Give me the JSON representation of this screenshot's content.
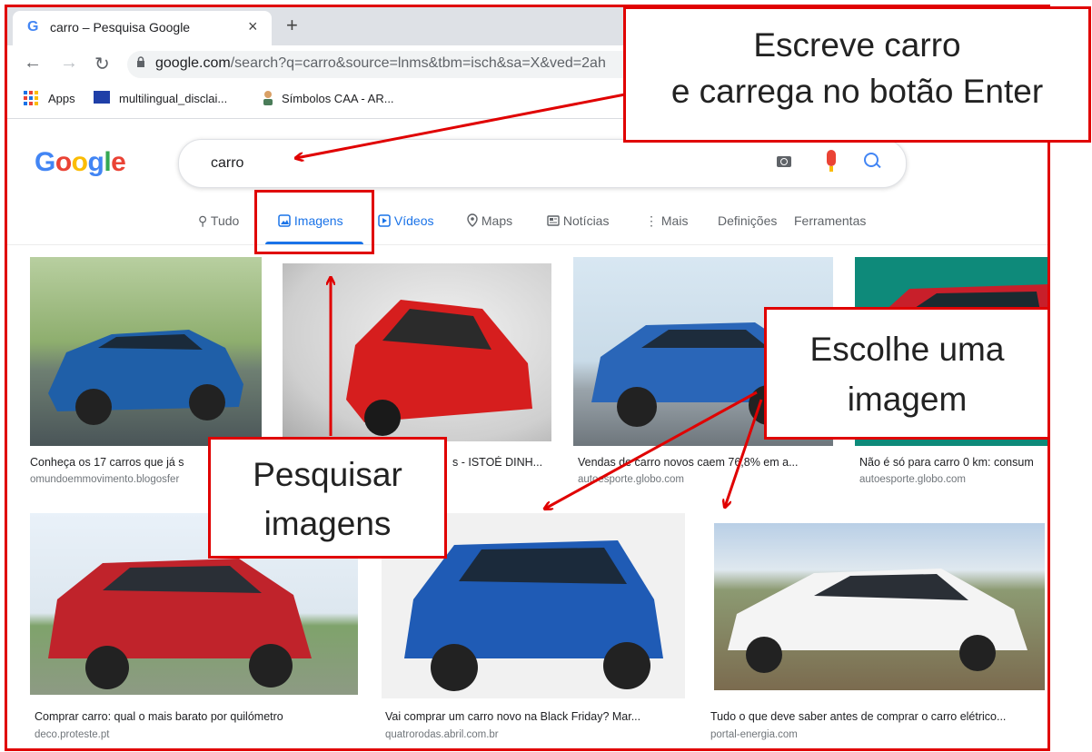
{
  "browser": {
    "tab_favicon": "G",
    "tab_title": "carro – Pesquisa Google",
    "tab_close": "×",
    "new_tab": "+",
    "url_host": "google.com",
    "url_path": "/search?q=carro&source=lnms&tbm=isch&sa=X&ved=2ah",
    "bookmarks": [
      {
        "label": "Apps"
      },
      {
        "label": "multilingual_disclai..."
      },
      {
        "label": "Símbolos CAA - AR..."
      }
    ]
  },
  "search": {
    "logo": "Google",
    "query": "carro"
  },
  "tabs": [
    {
      "label": "Tudo",
      "icon": "search-icon"
    },
    {
      "label": "Imagens",
      "icon": "image-icon",
      "active": true
    },
    {
      "label": "Vídeos",
      "icon": "play-icon"
    },
    {
      "label": "Maps",
      "icon": "map-pin-icon"
    },
    {
      "label": "Notícias",
      "icon": "news-icon"
    },
    {
      "label": "Mais",
      "icon": "more-vert-icon"
    },
    {
      "label": "Definições"
    },
    {
      "label": "Ferramentas"
    }
  ],
  "results": [
    {
      "caption": "Conheça os 17 carros que já s",
      "source": "omundoemmovimento.blogosfer",
      "color": "#1f5fa8"
    },
    {
      "caption": "s - ISTOÉ DINH...",
      "source": "",
      "color": "#d61e1e"
    },
    {
      "caption": "Vendas de carro novos caem 76,8% em a...",
      "source": "autoesporte.globo.com",
      "color": "#2a66b8"
    },
    {
      "caption": "Não é só para carro 0 km: consum",
      "source": "autoesporte.globo.com",
      "color": "#c81f2a"
    },
    {
      "caption": "Comprar carro: qual o mais barato por quilómetro",
      "source": "deco.proteste.pt",
      "color": "#c0232b"
    },
    {
      "caption": "Vai comprar um carro novo na Black Friday? Mar...",
      "source": "quatrorodas.abril.com.br",
      "color": "#1f5bb5"
    },
    {
      "caption": "Tudo o que deve saber antes de comprar o carro elétrico...",
      "source": "portal-energia.com",
      "color": "#f4f4f4"
    }
  ],
  "annotations": {
    "write": [
      "Escreve carro",
      "e carrega no botão Enter"
    ],
    "choose": [
      "Escolhe uma",
      "imagem"
    ],
    "search_images": [
      "Pesquisar",
      "imagens"
    ]
  },
  "colors": {
    "annotation": "#e00000",
    "accent": "#1a73e8"
  }
}
